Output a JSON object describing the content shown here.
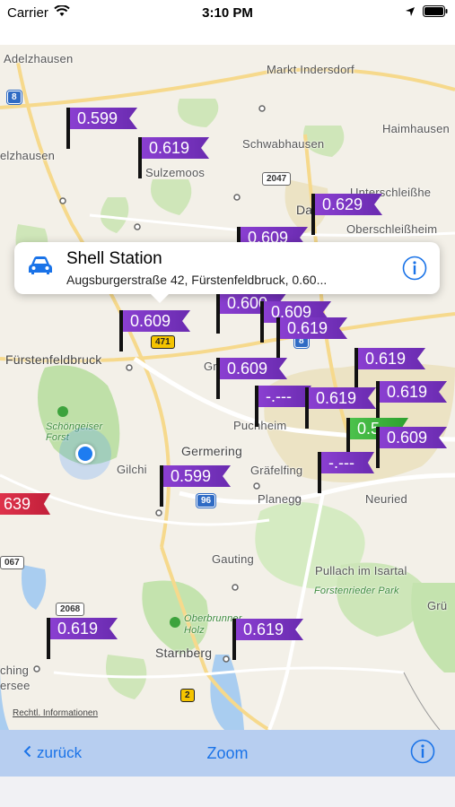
{
  "status_bar": {
    "carrier": "Carrier",
    "time": "3:10 PM"
  },
  "callout": {
    "title": "Shell Station",
    "subtitle": "Augsburgerstraße  42,  Fürstenfeldbruck, 0.60..."
  },
  "places": {
    "adelzhausen": "Adelzhausen",
    "markt_indersdorf": "Markt Indersdorf",
    "haimhausen": "Haimhausen",
    "elzhausen": "elzhausen",
    "sulzemoos": "Sulzemoos",
    "schwabhausen": "Schwabhausen",
    "unterschleissheim": "Unterschleißhe",
    "dachau": "Dachau",
    "oberschleissheim": "Oberschleißheim",
    "fuerstenfeldbruck": "Fürstenfeldbruck",
    "gilching_partial": "Gilchi",
    "germering": "Germering",
    "graefelfing": "Gräfelfing",
    "planegg": "Planegg",
    "neuried": "Neuried",
    "gauting": "Gauting",
    "pullach": "Pullach im Isartal",
    "forstenrieder": "Forstenrieder Park",
    "oberbrunner": "Oberbrunner\nHolz",
    "starnberg": "Starnberg",
    "schoengeiser": "Schöngeiser\nForst",
    "puchheim": "Puchheim",
    "gruen": "Grü",
    "ching": "ching",
    "ersee": "ersee",
    "gr": "Gr"
  },
  "road_shields": {
    "r8_top": "8",
    "r2047": "2047",
    "r471": "471",
    "r8_mid": "8",
    "r96": "96",
    "r2068": "2068",
    "r067": "067",
    "r2": "2"
  },
  "price_flags": [
    {
      "label": "0.599",
      "color": "purple"
    },
    {
      "label": "0.619",
      "color": "purple"
    },
    {
      "label": "0.629",
      "color": "purple"
    },
    {
      "label": "0.609",
      "color": "purple"
    },
    {
      "label": "0.609",
      "color": "purple"
    },
    {
      "label": "0.600",
      "color": "purple"
    },
    {
      "label": "0.609",
      "color": "purple"
    },
    {
      "label": "0.619",
      "color": "purple"
    },
    {
      "label": "0.609",
      "color": "purple"
    },
    {
      "label": "0.619",
      "color": "purple"
    },
    {
      "label": "-.---",
      "color": "purple"
    },
    {
      "label": "0.619",
      "color": "purple"
    },
    {
      "label": "0.619",
      "color": "purple"
    },
    {
      "label": "0.5..",
      "color": "green"
    },
    {
      "label": "0.609",
      "color": "purple"
    },
    {
      "label": "0.599",
      "color": "purple"
    },
    {
      "label": "-.---",
      "color": "purple"
    },
    {
      "label": "639",
      "color": "red"
    },
    {
      "label": "0.619",
      "color": "purple"
    },
    {
      "label": "0.619",
      "color": "purple"
    }
  ],
  "legal": "Rechtl. Informationen",
  "toolbar": {
    "back_label": "zurück",
    "zoom_label": "Zoom"
  },
  "colors": {
    "accent": "#1a73e8",
    "toolbar_bg": "#b7cef0",
    "flag_purple": "#7b35c4",
    "flag_green": "#3cb43c",
    "flag_red": "#d62a44"
  }
}
